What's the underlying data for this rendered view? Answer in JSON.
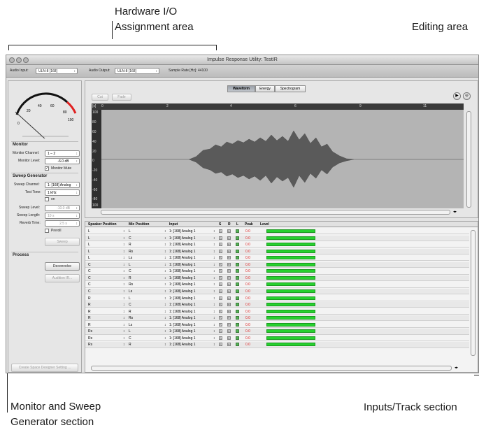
{
  "callouts": {
    "hw_line1": "Hardware I/O",
    "hw_line2": "Assignment area",
    "editing": "Editing area",
    "monitor_line1": "Monitor and Sweep",
    "monitor_line2": "Generator section",
    "inputs": "Inputs/Track section"
  },
  "window": {
    "title": "Impulse Response Utility: TestIR"
  },
  "toolbar": {
    "audio_input_label": "Audio Input:",
    "audio_input_value": "ULN-8 [168]",
    "audio_output_label": "Audio Output:",
    "audio_output_value": "ULN-8 [168]",
    "sample_rate": "Sample Rate [Hz]: 44100"
  },
  "meter": {
    "ticks": [
      "0",
      "20",
      "40",
      "60",
      "80",
      "100"
    ]
  },
  "monitor": {
    "title": "Monitor",
    "channel_label": "Monitor Channel:",
    "channel_value": "1 – 2",
    "level_label": "Monitor  Level:",
    "level_value": "-6.0 dB",
    "mute_label": "Monitor Mute"
  },
  "sweep": {
    "title": "Sweep Generator",
    "channel_label": "Sweep Channel:",
    "channel_value": "1: [168] Analog",
    "tone_label": "Test Tone:",
    "tone_value": "1 kHz",
    "on_label": "on",
    "level_label": "Sweep Level:",
    "level_value": "-10.0 dB",
    "length_label": "Sweep Length:",
    "length_value": "10 s",
    "reverb_label": "Reverb Time:",
    "reverb_value": "2.5 s",
    "preroll_label": "Preroll",
    "sweep_button": "Sweep"
  },
  "process": {
    "title": "Process",
    "deconvolve": "Deconvolve",
    "audition": "Audition IR...",
    "create": "Create Space Designer Setting ..."
  },
  "editor": {
    "cut": "Cut",
    "fade": "Fade",
    "tabs": [
      "Waveform",
      "Energy",
      "Spectrogram"
    ],
    "active_tab": "Waveform",
    "ruler_unit": "[s]",
    "ruler_ticks": [
      "0",
      "2",
      "4",
      "6",
      "9",
      "11"
    ],
    "y_ticks": [
      "100",
      "80",
      "60",
      "40",
      "20",
      "0",
      "-20",
      "-40",
      "-60",
      "-80",
      "100"
    ]
  },
  "tracks": {
    "headers": {
      "speaker": "Speaker Position",
      "mic": "Mic Position",
      "input": "Input",
      "s": "S",
      "r": "R",
      "l": "L",
      "peak": "Peak",
      "level": "Level"
    },
    "rows": [
      {
        "speaker": "L",
        "mic": "L",
        "input": "1: [168] Analog 1",
        "peak": "0.0"
      },
      {
        "speaker": "L",
        "mic": "C",
        "input": "1: [168] Analog 1",
        "peak": "0.0"
      },
      {
        "speaker": "L",
        "mic": "R",
        "input": "1: [168] Analog 1",
        "peak": "0.0"
      },
      {
        "speaker": "L",
        "mic": "Rs",
        "input": "1: [168] Analog 1",
        "peak": "0.0"
      },
      {
        "speaker": "L",
        "mic": "Ls",
        "input": "1: [168] Analog 1",
        "peak": "0.0"
      },
      {
        "speaker": "C",
        "mic": "L",
        "input": "1: [168] Analog 1",
        "peak": "0.0"
      },
      {
        "speaker": "C",
        "mic": "C",
        "input": "1: [168] Analog 1",
        "peak": "0.0"
      },
      {
        "speaker": "C",
        "mic": "R",
        "input": "1: [168] Analog 1",
        "peak": "0.0"
      },
      {
        "speaker": "C",
        "mic": "Rs",
        "input": "1: [168] Analog 1",
        "peak": "0.0"
      },
      {
        "speaker": "C",
        "mic": "Ls",
        "input": "1: [168] Analog 1",
        "peak": "0.0"
      },
      {
        "speaker": "R",
        "mic": "L",
        "input": "1: [168] Analog 1",
        "peak": "0.0"
      },
      {
        "speaker": "R",
        "mic": "C",
        "input": "1: [168] Analog 1",
        "peak": "0.0"
      },
      {
        "speaker": "R",
        "mic": "R",
        "input": "1: [168] Analog 1",
        "peak": "0.0"
      },
      {
        "speaker": "R",
        "mic": "Rs",
        "input": "1: [168] Analog 1",
        "peak": "0.0"
      },
      {
        "speaker": "R",
        "mic": "Ls",
        "input": "1: [168] Analog 1",
        "peak": "0.0"
      },
      {
        "speaker": "Rs",
        "mic": "L",
        "input": "1: [168] Analog 1",
        "peak": "0.0"
      },
      {
        "speaker": "Rs",
        "mic": "C",
        "input": "1: [168] Analog 1",
        "peak": "0.0"
      },
      {
        "speaker": "Rs",
        "mic": "R",
        "input": "1: [168] Analog 1",
        "peak": "0.0"
      }
    ],
    "s_glyph": "S",
    "r_glyph": "R"
  },
  "colors": {
    "level_meter": "#27d02f",
    "peak": "#d22222",
    "meter_red": "#e02020"
  }
}
